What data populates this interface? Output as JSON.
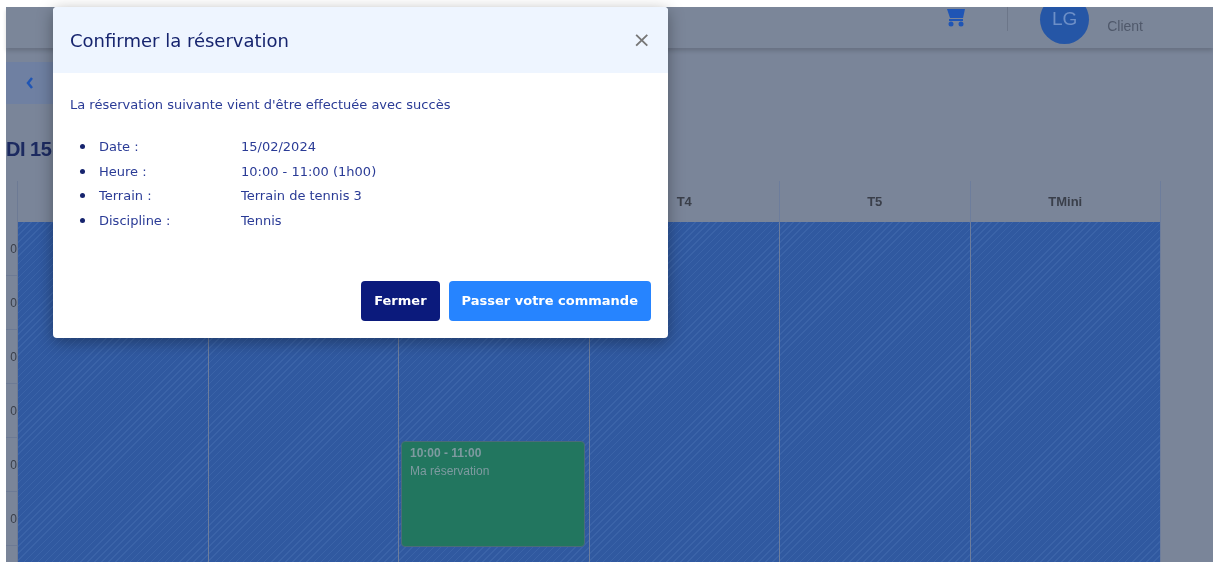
{
  "header": {
    "avatar_initials": "LG",
    "role": "Client"
  },
  "page_title": "DI 15",
  "columns": [
    {},
    {},
    {
      "events": [
        {
          "time": "10:00 - 11:00",
          "label": "Ma réservation",
          "color": "#22765f"
        }
      ]
    },
    {
      "label": "T4"
    },
    {
      "label": "T5"
    },
    {
      "label": "TMini"
    }
  ],
  "time_labels": [
    "0",
    "0",
    "0",
    "0",
    "0",
    "0"
  ],
  "modal": {
    "title": "Confirmer la réservation",
    "close": "×",
    "message": "La réservation suivante vient d'être effectuée avec succès",
    "details": [
      {
        "label": "Date :",
        "value": "15/02/2024"
      },
      {
        "label": "Heure :",
        "value": "10:00 - 11:00 (1h00)"
      },
      {
        "label": "Terrain :",
        "value": "Terrain de tennis 3"
      },
      {
        "label": "Discipline :",
        "value": "Tennis"
      }
    ],
    "buttons": [
      {
        "label": "Fermer",
        "kind": "secondary"
      },
      {
        "label": "Passer votre commande",
        "kind": "primary"
      }
    ]
  }
}
